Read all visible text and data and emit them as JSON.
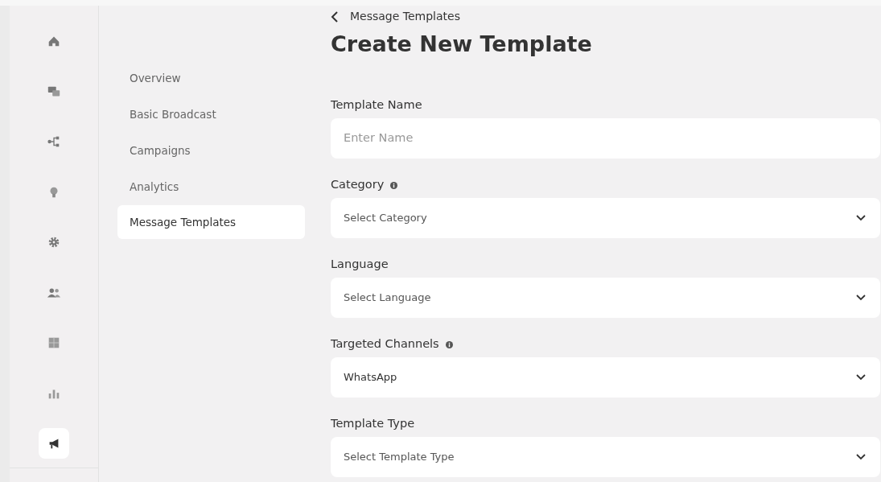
{
  "rail": [
    {
      "selected": false
    },
    {
      "selected": false
    },
    {
      "selected": false
    },
    {
      "selected": false
    },
    {
      "selected": false
    },
    {
      "selected": false
    },
    {
      "selected": false
    },
    {
      "selected": false
    },
    {
      "selected": true
    }
  ],
  "submenu": [
    {
      "label": "Overview",
      "selected": false
    },
    {
      "label": "Basic Broadcast",
      "selected": false
    },
    {
      "label": "Campaigns",
      "selected": false
    },
    {
      "label": "Analytics",
      "selected": false
    },
    {
      "label": "Message Templates",
      "selected": true
    }
  ],
  "breadcrumb": "Message Templates",
  "title": "Create New Template",
  "fields": [
    {
      "label": "Template Name",
      "info": false,
      "kind": "text",
      "placeholder": "Enter Name"
    },
    {
      "label": "Category",
      "info": true,
      "kind": "select",
      "placeholder": "Select Category"
    },
    {
      "label": "Language",
      "info": false,
      "kind": "select",
      "placeholder": "Select Language"
    },
    {
      "label": "Targeted Channels",
      "info": true,
      "kind": "select",
      "value": "WhatsApp"
    },
    {
      "label": "Template Type",
      "info": false,
      "kind": "select",
      "placeholder": "Select Template Type"
    }
  ]
}
